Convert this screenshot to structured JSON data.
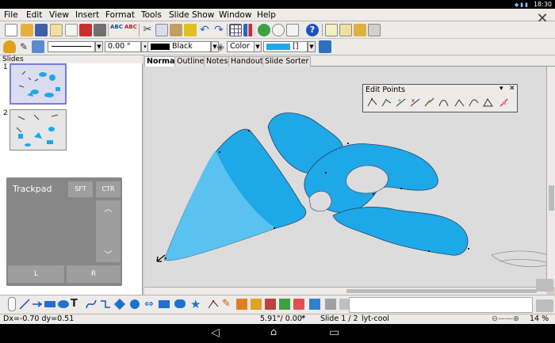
{
  "status_bar": {
    "time": "18:30"
  },
  "menu": [
    "File",
    "Edit",
    "View",
    "Insert",
    "Format",
    "Tools",
    "Slide Show",
    "Window",
    "Help"
  ],
  "line_width": "0.00 \"",
  "line_color_name": "Black",
  "area_fill_type": "Color",
  "area_fill_value": "[]",
  "colors": {
    "shape_fill": "#1ea8e8",
    "shape_fill_selected": "#5ac2f0",
    "trackpad_bg": "#878787",
    "slide_selected": "#7a7ae0",
    "fill_swatch": "#1ea8e8"
  },
  "slides_panel": {
    "header": "Slides",
    "slides": [
      {
        "number": "1"
      },
      {
        "number": "2"
      }
    ]
  },
  "trackpad": {
    "title": "Trackpad",
    "shift_label": "SFT",
    "ctrl_label": "CTR",
    "scroll_up": "^",
    "scroll_down": "v",
    "left_label": "L",
    "right_label": "R"
  },
  "tabs": [
    "Normal",
    "Outline",
    "Notes",
    "Handout",
    "Slide Sorter"
  ],
  "edit_points": {
    "title": "Edit Points"
  },
  "status": {
    "delta": "Dx=-0.70 dy=0.51",
    "position": "5.91\"/ 0.00\"",
    "modified": "*",
    "slide": "Slide 1 / 2",
    "layout": "lyt-cool",
    "zoom": "14 %"
  },
  "icons": {
    "toolbar": [
      "new-icon",
      "open-icon",
      "save-icon",
      "email-icon",
      "edit-file-icon",
      "export-pdf-icon",
      "print-icon",
      "spellcheck-icon",
      "autospell-icon",
      "cut-icon",
      "copy-icon",
      "paste-icon",
      "clone-format-icon",
      "undo-icon",
      "redo-icon",
      "table-icon",
      "chart-icon",
      "gallery-icon",
      "navigator-icon",
      "zoom-icon",
      "help-icon",
      "slide-icon",
      "slide-layout-icon",
      "slide-design-icon",
      "master-icon"
    ],
    "draw": [
      "select-icon",
      "line-icon",
      "arrow-icon",
      "rectangle-icon",
      "ellipse-icon",
      "text-icon",
      "curve-icon",
      "connector-icon",
      "basic-shapes-icon",
      "symbol-shapes-icon",
      "block-arrows-icon",
      "flowchart-icon",
      "callouts-icon",
      "stars-icon",
      "points-icon",
      "glue-points-icon",
      "fontwork-icon",
      "from-file-icon",
      "gallery-icon",
      "extrusion-icon",
      "rotate-icon",
      "align-icon",
      "arrange-icon",
      "shadow-icon"
    ]
  }
}
